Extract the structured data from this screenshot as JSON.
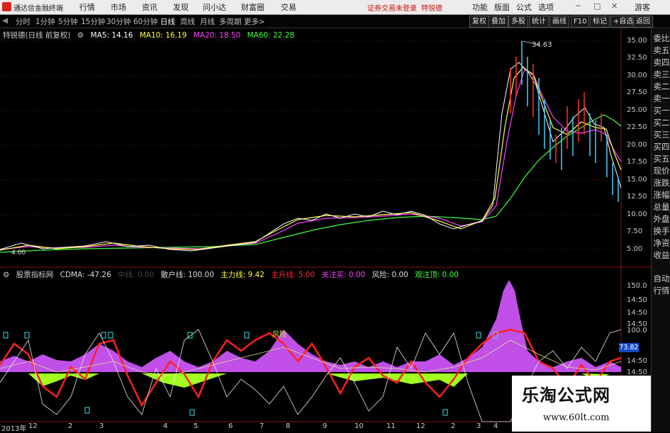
{
  "app": {
    "title": "通达信金融终端"
  },
  "menu": [
    "行情",
    "市场",
    "资讯",
    "发现",
    "问小达",
    "财富圈",
    "交易"
  ],
  "warning": "证券交易未登录",
  "stock_name_top": "特锐德",
  "right_menu": [
    "功能",
    "版面",
    "公式",
    "选项"
  ],
  "window_controls": {
    "logout": "游客"
  },
  "periods": [
    "分时",
    "1分钟",
    "5分钟",
    "15分钟",
    "30分钟",
    "60分钟",
    "日线",
    "周线",
    "月线",
    "多周期",
    "更多>"
  ],
  "toolbar_right": [
    "复权",
    "叠加",
    "多股",
    "统计",
    "画线",
    "F10",
    "标记",
    "+自选",
    "返回"
  ],
  "main_legend": {
    "title": "特锐德(日线 前复权)",
    "ma5": "MA5: 14.16",
    "ma10": "MA10: 16.19",
    "ma20": "MA20: 18.50",
    "ma60": "MA60: 22.28",
    "high_label": "34.63",
    "low_label": "4.00"
  },
  "sub_legend": {
    "name": "股票指标网",
    "cdma": "CDMA: -47.26",
    "x1": "中线: 0.00",
    "sanhu": "散户线: 100.00",
    "zhuli": "主力线: 9.42",
    "zhuyi": "主升线: 5.00",
    "guanzhu": "关注买: 0.00",
    "fengxian": "风险: 0.00",
    "shizhu": "观注顶: 0.00",
    "fengxian_marker": "风险"
  },
  "sub_value_box": "73.82",
  "main_yaxis": [
    "35.00",
    "32.50",
    "30.00",
    "27.50",
    "25.00",
    "22.50",
    "20.00",
    "17.50",
    "15.00",
    "12.50",
    "10.00",
    "7.50",
    "5.00"
  ],
  "sub_yaxis": [
    "150.0",
    "14:50",
    "14:50",
    "14:50",
    "100.0",
    "14:50",
    "14:50"
  ],
  "x_labels": [
    "2013年",
    "12",
    "2",
    "3",
    "4",
    "5",
    "6",
    "7",
    "8",
    "9",
    "10",
    "11",
    "12",
    "2",
    "3",
    "4",
    "5"
  ],
  "sidebar": [
    "委比",
    "卖五",
    "卖四",
    "卖三",
    "卖二",
    "卖一",
    "买一",
    "买二",
    "买三",
    "买四",
    "买五",
    "现价",
    "涨跌",
    "涨幅",
    "总量",
    "外盘",
    "换手",
    "净资",
    "收益",
    "自动",
    "行情"
  ],
  "watermark": {
    "line1": "乐淘公式网",
    "line2": "www.60lt.com"
  },
  "colors": {
    "ma5": "#ffffff",
    "ma10": "#ffff40",
    "ma20": "#ff40ff",
    "ma60": "#40ff40",
    "up": "#ff3030",
    "down": "#40d0ff",
    "red_line": "#ff2020",
    "magenta_bar": "#d060ff",
    "green_bar": "#a0ff20"
  }
}
